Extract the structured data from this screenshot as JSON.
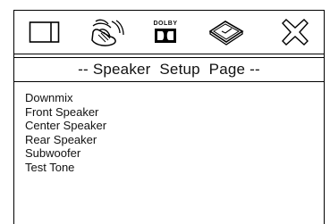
{
  "icons": [
    {
      "name": "general-setup-icon"
    },
    {
      "name": "speaker-setup-icon"
    },
    {
      "name": "dolby-digital-icon",
      "brand_text": "DOLBY"
    },
    {
      "name": "preferences-disc-icon"
    },
    {
      "name": "exit-icon"
    }
  ],
  "page": {
    "title": "-- Speaker  Setup  Page --"
  },
  "menu": {
    "items": [
      {
        "label": "Downmix"
      },
      {
        "label": "Front Speaker"
      },
      {
        "label": "Center Speaker"
      },
      {
        "label": "Rear Speaker"
      },
      {
        "label": "Subwoofer"
      },
      {
        "label": "Test Tone"
      }
    ]
  }
}
